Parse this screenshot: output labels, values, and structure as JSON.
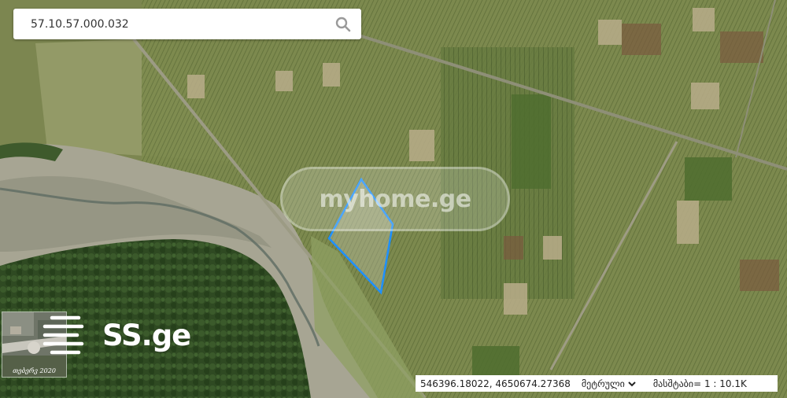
{
  "search": {
    "value": "57.10.57.000.032"
  },
  "icons": {
    "search": "search-icon",
    "menu": "menu-lines-icon",
    "chevron": "chevron-down-icon"
  },
  "watermark": {
    "text": "myhome.ge"
  },
  "basemap": {
    "label": "თებერვ 2020"
  },
  "brand": {
    "text": "SS.ge"
  },
  "status": {
    "coordinates": "546396.18022, 4650674.27368",
    "units": "მეტრული",
    "scale": "მასშტაბი= 1 : 10.1K"
  },
  "colors": {
    "parcel_outline": "#1e90ff",
    "accent": "#ffffff"
  }
}
